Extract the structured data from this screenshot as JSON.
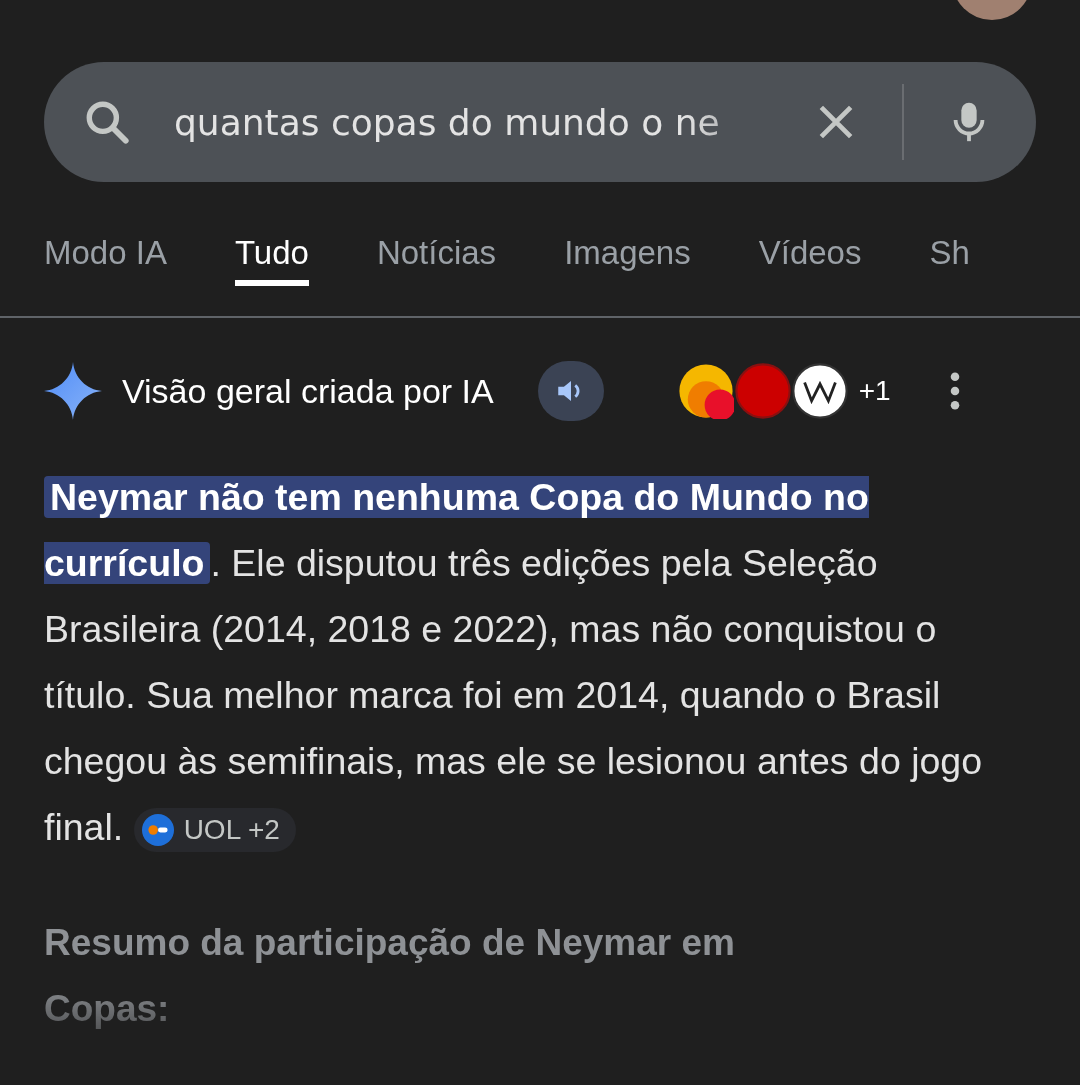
{
  "search": {
    "value": "quantas copas do mundo o ne"
  },
  "tabs": [
    {
      "label": "Modo IA",
      "selected": false
    },
    {
      "label": "Tudo",
      "selected": true
    },
    {
      "label": "Notícias",
      "selected": false
    },
    {
      "label": "Imagens",
      "selected": false
    },
    {
      "label": "Vídeos",
      "selected": false
    },
    {
      "label": "Sh",
      "selected": false
    }
  ],
  "overview": {
    "title": "Visão geral criada por IA",
    "sources_more": "+1",
    "answer": "**Neymar não tem nenhuma Copa do Mundo no currículo**. Ele disputou três edições pela Seleção Brasileira (2014, 2018 e 2022), mas não conquistou o título. Sua melhor marca foi em 2014, quando o Brasil chegou às semifinais, mas ele se lesionou antes do jogo final.",
    "citation": "UOL +2",
    "heading": "Resumo da participação de Neymar em Copas:"
  }
}
